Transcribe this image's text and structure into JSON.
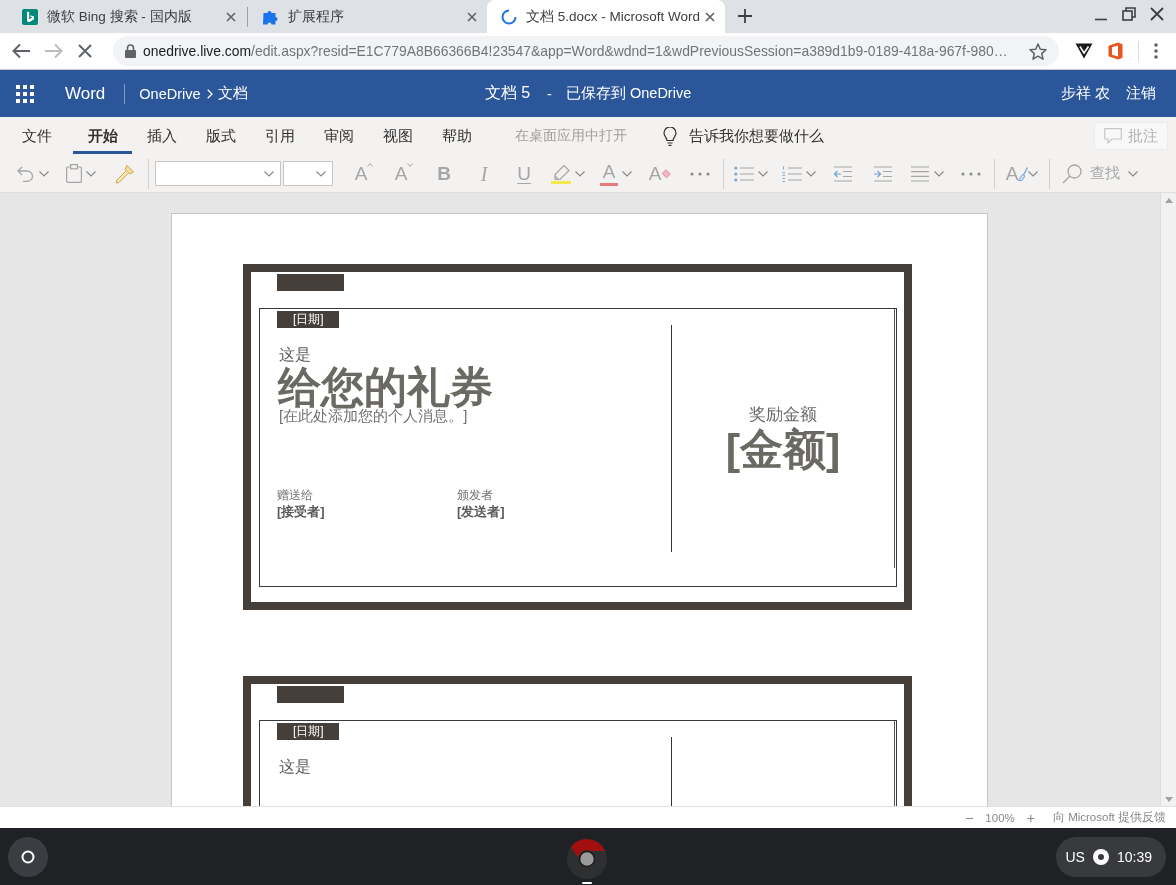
{
  "browser": {
    "tabs": [
      {
        "title": "微软 Bing 搜索 - 国内版",
        "selected": false,
        "loading": false
      },
      {
        "title": "扩展程序",
        "selected": false,
        "loading": false
      },
      {
        "title": "文档 5.docx - Microsoft Word",
        "selected": true,
        "loading": true
      }
    ],
    "address": {
      "domain": "onedrive.live.com",
      "path": "/edit.aspx?resid=E1C779A8B66366B4!23547&app=Word&wdnd=1&wdPreviousSession=a389d1b9-0189-418a-967f-980…"
    }
  },
  "app_bar": {
    "app": "Word",
    "breadcrumb": [
      "OneDrive",
      "文档"
    ],
    "document": "文档 5",
    "separator": "-",
    "save_status": "已保存到 OneDrive",
    "user": "步祥 农",
    "sign_out": "注销"
  },
  "ribbon": {
    "tabs": [
      {
        "label": "文件",
        "selected": false
      },
      {
        "label": "开始",
        "selected": true
      },
      {
        "label": "插入",
        "selected": false
      },
      {
        "label": "版式",
        "selected": false
      },
      {
        "label": "引用",
        "selected": false
      },
      {
        "label": "审阅",
        "selected": false
      },
      {
        "label": "视图",
        "selected": false
      },
      {
        "label": "帮助",
        "selected": false
      }
    ],
    "open_in_desktop": {
      "label": "在桌面应用中打开",
      "disabled": true
    },
    "tell_me": "告诉我你想要做什么",
    "comments": {
      "label": "批注",
      "disabled": true
    }
  },
  "toolbar": [
    {
      "kind": "undo",
      "dropdown": true
    },
    {
      "kind": "paste",
      "dropdown": true
    },
    {
      "kind": "format_painter",
      "dropdown": false
    },
    {
      "kind": "separator"
    },
    {
      "kind": "font_box",
      "dropdown": true
    },
    {
      "kind": "size_box",
      "dropdown": true
    },
    {
      "kind": "grow_font",
      "glyph": "A",
      "dropdown": false
    },
    {
      "kind": "shrink_font",
      "glyph": "A",
      "dropdown": false
    },
    {
      "kind": "bold",
      "glyph": "B",
      "dropdown": false
    },
    {
      "kind": "italic",
      "glyph": "I",
      "dropdown": false
    },
    {
      "kind": "underline",
      "glyph": "U",
      "dropdown": false
    },
    {
      "kind": "highlight",
      "dropdown": true
    },
    {
      "kind": "font_color",
      "glyph": "A",
      "dropdown": true
    },
    {
      "kind": "clear_format",
      "glyph": "A",
      "dropdown": false
    },
    {
      "kind": "more",
      "dropdown": false
    },
    {
      "kind": "separator"
    },
    {
      "kind": "bullets",
      "dropdown": true
    },
    {
      "kind": "numbering",
      "dropdown": true
    },
    {
      "kind": "outdent",
      "dropdown": false
    },
    {
      "kind": "indent",
      "dropdown": false
    },
    {
      "kind": "align",
      "dropdown": true
    },
    {
      "kind": "more",
      "dropdown": false
    },
    {
      "kind": "separator"
    },
    {
      "kind": "styles",
      "glyph": "A",
      "dropdown": true
    },
    {
      "kind": "separator"
    },
    {
      "kind": "find",
      "label": "查找",
      "dropdown": true
    }
  ],
  "document": {
    "coupons": [
      {
        "date": "[日期]",
        "intro": "这是",
        "title": "给您的礼券",
        "message": "[在此处添加您的个人消息。]",
        "to_label": "赠送给",
        "to": "[接受者]",
        "from_label": "颁发者",
        "from": "[发送者]",
        "amount_label": "奖励金额",
        "amount": "[金额]"
      },
      {
        "date": "[日期]",
        "intro": "这是"
      }
    ]
  },
  "status_bar": {
    "zoom_out": "−",
    "zoom": "100%",
    "zoom_in": "+",
    "feedback": "向 Microsoft 提供反馈"
  },
  "shelf": {
    "keyboard": "US",
    "time": "10:39"
  }
}
